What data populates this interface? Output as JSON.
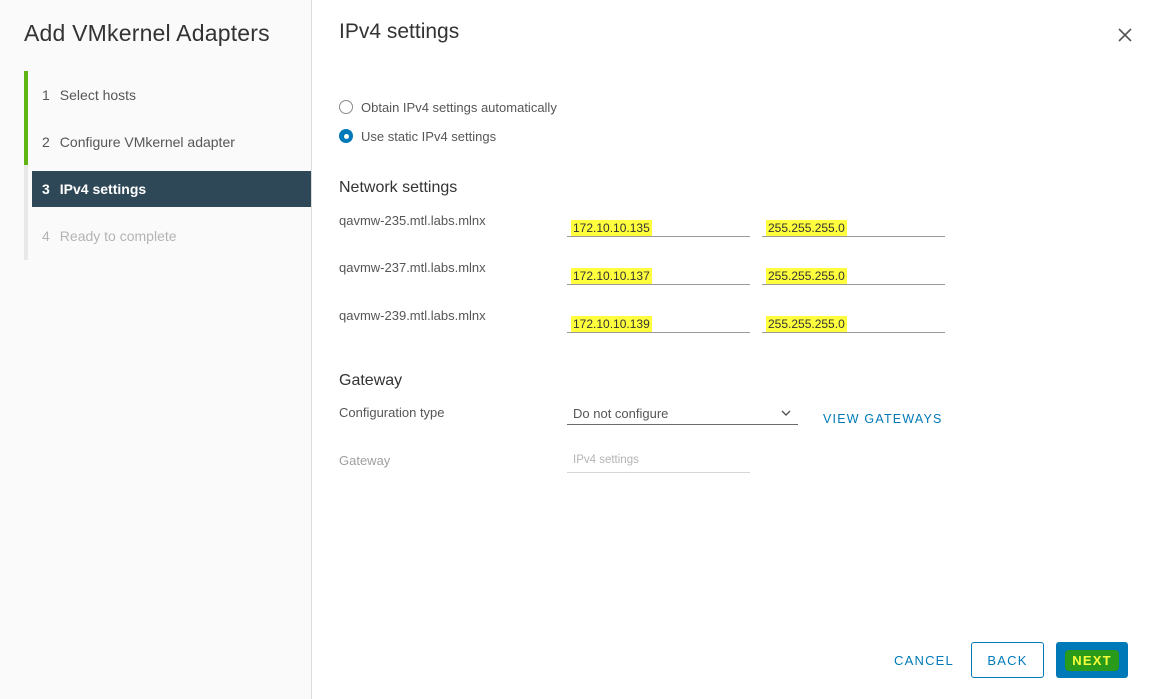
{
  "wizard": {
    "title": "Add VMkernel Adapters",
    "steps": [
      {
        "num": "1",
        "label": "Select hosts",
        "state": "done"
      },
      {
        "num": "2",
        "label": "Configure VMkernel adapter",
        "state": "done"
      },
      {
        "num": "3",
        "label": "IPv4 settings",
        "state": "active"
      },
      {
        "num": "4",
        "label": "Ready to complete",
        "state": "disabled"
      }
    ]
  },
  "page": {
    "title": "IPv4 settings",
    "close_icon": "close-icon"
  },
  "ipv4_mode": {
    "options": [
      {
        "label": "Obtain IPv4 settings automatically",
        "checked": false
      },
      {
        "label": "Use static IPv4 settings",
        "checked": true
      }
    ]
  },
  "network_settings": {
    "title": "Network settings",
    "hosts": [
      {
        "name": "qavmw-235.mtl.labs.mlnx",
        "ip": "172.10.10.135",
        "mask": "255.255.255.0"
      },
      {
        "name": "qavmw-237.mtl.labs.mlnx",
        "ip": "172.10.10.137",
        "mask": "255.255.255.0"
      },
      {
        "name": "qavmw-239.mtl.labs.mlnx",
        "ip": "172.10.10.139",
        "mask": "255.255.255.0"
      }
    ]
  },
  "gateway": {
    "title": "Gateway",
    "config_type_label": "Configuration type",
    "config_type_value": "Do not configure",
    "view_gateways": "VIEW GATEWAYS",
    "gateway_label": "Gateway",
    "gateway_placeholder": "IPv4 settings"
  },
  "footer": {
    "cancel": "CANCEL",
    "back": "BACK",
    "next": "NEXT"
  },
  "colors": {
    "accent": "#0079b8",
    "active_step_bg": "#2f4858",
    "done_step": "#60b515",
    "highlight": "#ffff3d"
  }
}
